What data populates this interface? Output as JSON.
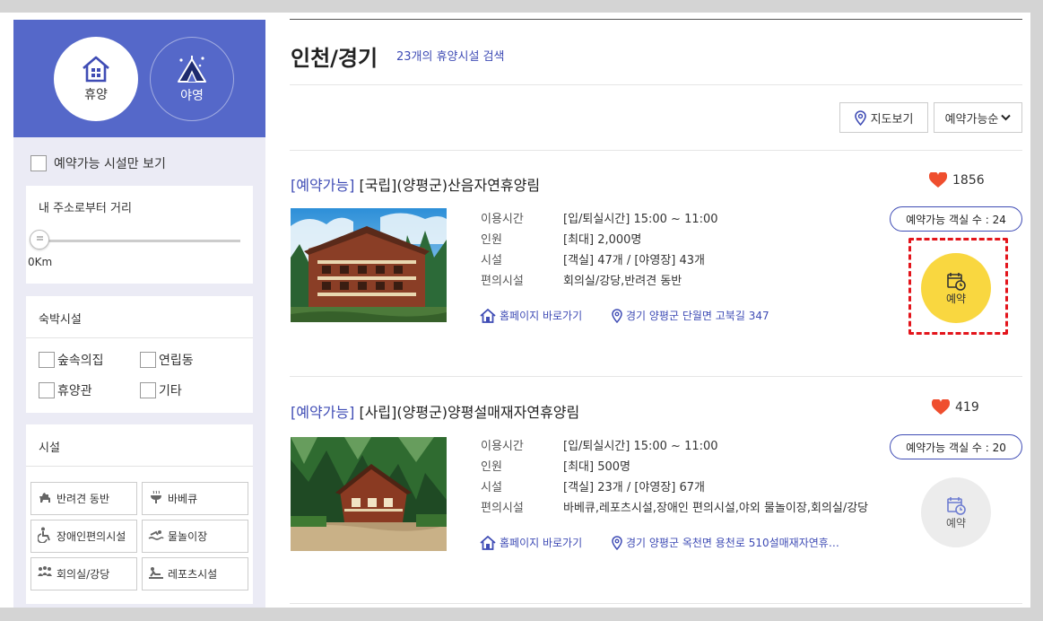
{
  "sidebar": {
    "categories": [
      {
        "label": "휴양",
        "icon": "house-icon",
        "active": true
      },
      {
        "label": "야영",
        "icon": "tent-icon",
        "active": false
      }
    ],
    "available_only_label": "예약가능 시설만 보기",
    "distance": {
      "title": "내 주소로부터 거리",
      "value_label": "0Km",
      "value": 0
    },
    "lodging": {
      "title": "숙박시설",
      "options": [
        "숲속의집",
        "연립동",
        "휴양관",
        "기타"
      ]
    },
    "facilities": {
      "title": "시설",
      "options": [
        {
          "label": "반려견 동반",
          "icon": "dog-icon"
        },
        {
          "label": "바베큐",
          "icon": "grill-icon"
        },
        {
          "label": "장애인편의시설",
          "icon": "wheelchair-icon"
        },
        {
          "label": "물놀이장",
          "icon": "swim-icon"
        },
        {
          "label": "회의실/강당",
          "icon": "meeting-icon"
        },
        {
          "label": "레포츠시설",
          "icon": "sports-icon"
        }
      ]
    }
  },
  "main": {
    "title": "인천/경기",
    "result_count": "23개의 휴양시설 검색",
    "map_button": "지도보기",
    "sort_button": "예약가능순"
  },
  "items": [
    {
      "status_tag": "[예약가능]",
      "name": "[국립](양평군)산음자연휴양림",
      "likes": "1856",
      "rows": [
        {
          "k": "이용시간",
          "v": "[입/퇴실시간] 15:00 ~ 11:00"
        },
        {
          "k": "인원",
          "v": "[최대] 2,000명"
        },
        {
          "k": "시설",
          "v": "[객실] 47개 / [야영장] 43개"
        },
        {
          "k": "편의시설",
          "v": "회의실/강당,반려견 동반"
        }
      ],
      "homepage_link": "홈페이지 바로가기",
      "address": "경기 양평군 단월면 고북길 347",
      "rooms_available": "예약가능 객실 수 : 24",
      "reserve_label": "예약",
      "reserve_enabled": true
    },
    {
      "status_tag": "[예약가능]",
      "name": "[사립](양평군)양평설매재자연휴양림",
      "likes": "419",
      "rows": [
        {
          "k": "이용시간",
          "v": "[입/퇴실시간] 15:00 ~ 11:00"
        },
        {
          "k": "인원",
          "v": "[최대] 500명"
        },
        {
          "k": "시설",
          "v": "[객실] 23개 / [야영장] 67개"
        },
        {
          "k": "편의시설",
          "v": "바베큐,레포츠시설,장애인 편의시설,야외 물놀이장,회의실/강당"
        }
      ],
      "homepage_link": "홈페이지 바로가기",
      "address": "경기 양평군 옥천면 용천로 510설매재자연휴…",
      "rooms_available": "예약가능 객실 수 : 20",
      "reserve_label": "예약",
      "reserve_enabled": false
    }
  ],
  "colors": {
    "brand": "#5568c9",
    "accent_blue": "#3f4cb5",
    "heart": "#ef4e2e",
    "reserve_active": "#f9d740",
    "highlight": "#e3141b"
  }
}
